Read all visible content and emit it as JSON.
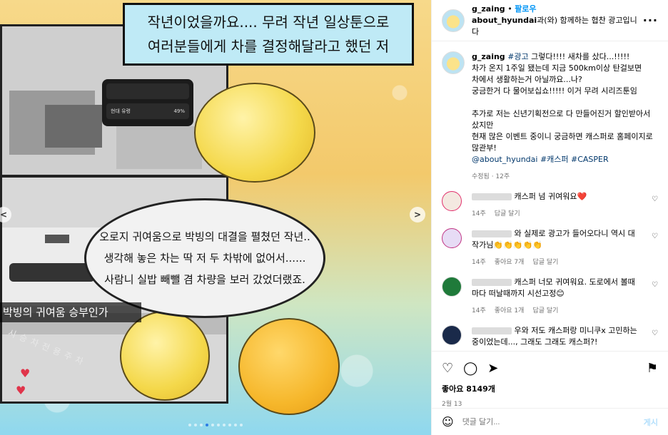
{
  "media": {
    "caption_box": [
      "작년이었을까요.... 무려 작년 일상툰으로",
      "여러분들에게 차를 결정해달라고 했던 저"
    ],
    "stat_card": {
      "rows": [
        {
          "label": "",
          "value": ""
        },
        {
          "label": "현대 유령",
          "value": "49%"
        }
      ]
    },
    "speech": [
      "오로지 귀여움으로 박빙의 대결을 펼쳤던 작년..",
      "생각해 놓은 차는 딱 저 두 차밖에 없어서......",
      "사람니 실밥 빼뺄 겸 차량을 보러 갔었더랬죠."
    ],
    "car_label": "박빙의 귀여움 승부인가",
    "parking_text": "시 승 차 전 용 주 차",
    "prev_arrow": "<",
    "next_arrow": ">",
    "dots_count": 10,
    "active_dot": 3
  },
  "header": {
    "username": "g_zaing",
    "separator": "•",
    "follow": "팔로우",
    "partner": "about_hyundai",
    "partner_suffix": "과(와) 함께하는 협찬 광고입니다",
    "more": "···"
  },
  "caption": {
    "username": "g_zaing",
    "tag_ad": "#광고",
    "line1": " 그렇다!!!! 새차를 샀다...!!!!!",
    "line2": "차가 온지 1주일 됐는데 지금 500km이상 탄걸보면",
    "line3": "차에서 생활하는거 아닐까요...나?",
    "line4": "궁금한거 다 물어보십쇼!!!!! 이거 무려 시리즈툰임",
    "line5": "추가로 저는 신년기획전으로 다 만들어진거 할인받아서",
    "line6": "샀지만",
    "line7": "현재 많은 이벤트 중이니 궁금하면 캐스퍼로 홈페이지로",
    "line8": "많관부!",
    "mentions": "@about_hyundai #캐스퍼 #CASPER",
    "meta": "수정됨 · 12주"
  },
  "comments": [
    {
      "text": " 캐스퍼 넘 귀여워요❤️",
      "time": "14주",
      "likes": "",
      "reply": "답글 달기"
    },
    {
      "text": " 와 실제로 광고가 들어오다니 역시 대작가님👏👏👏👏👏",
      "time": "14주",
      "likes": "좋아요 7개",
      "reply": "답글 달기"
    },
    {
      "text": " 캐스퍼 너모 귀여워요. 도로에서 볼때마다 떠날때까지 시선고정😊",
      "time": "14주",
      "likes": "좋아요 1개",
      "reply": "답글 달기"
    },
    {
      "text": " 우와 저도 캐스퍼랑 미니쿠x 고민하는중이었는데..., 그래도 그래도 캐스퍼?!",
      "time": "",
      "likes": "",
      "reply": ""
    }
  ],
  "actions": {
    "likes": "좋아요 8149개",
    "date": "2월 13"
  },
  "compose": {
    "placeholder": "댓글 달기...",
    "post": "게시"
  }
}
